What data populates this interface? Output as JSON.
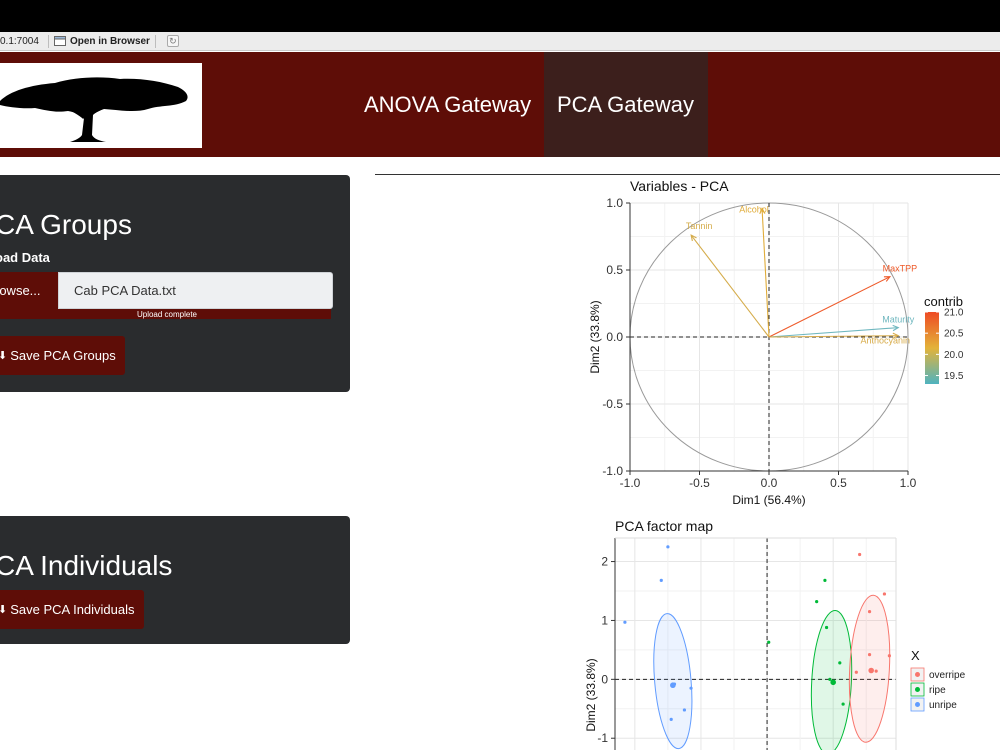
{
  "browser": {
    "url": "0.1:7004",
    "open_label": "Open in Browser"
  },
  "nav": {
    "links": [
      {
        "label": "ANOVA Gateway"
      },
      {
        "label": "PCA Gateway"
      }
    ]
  },
  "groups_panel": {
    "title": "CA Groups",
    "upload_label": "oad Data",
    "browse_label": "rowse...",
    "file_name": "Cab PCA Data.txt",
    "progress_text": "Upload complete",
    "progress": 1.0,
    "save_label": "Save PCA Groups"
  },
  "individuals_panel": {
    "title": "CA Individuals",
    "save_label": "Save PCA Individuals"
  },
  "colors": {
    "nav_bg": "#5e0d07",
    "nav_active": "#3c1f1c",
    "panel_bg": "#2a2c2e",
    "input_bg": "#eef0f2"
  },
  "chart_data": [
    {
      "type": "scatter",
      "title": "Variables - PCA",
      "xlabel": "Dim1 (56.4%)",
      "ylabel": "Dim2 (33.8%)",
      "xlim": [
        -1.0,
        1.0
      ],
      "ylim": [
        -1.0,
        1.0
      ],
      "xticks": [
        "-1.0",
        "-0.5",
        "0.0",
        "0.5",
        "1.0"
      ],
      "yticks": [
        "-1.0",
        "-0.5",
        "0.0",
        "0.5",
        "1.0"
      ],
      "grid": true,
      "circle": true,
      "legend": {
        "title": "contrib",
        "position": "right",
        "ticks": [
          "21.0",
          "20.5",
          "20.0",
          "19.5"
        ],
        "tick_values": [
          21.0,
          20.5,
          20.0,
          19.5
        ],
        "range": [
          19.3,
          21.0
        ],
        "low_color": "#4fb3bf",
        "mid_color": "#e3b33a",
        "high_color": "#ee4b24"
      },
      "arrows": [
        {
          "name": "Tannin",
          "x": -0.56,
          "y": 0.76,
          "color": "#d5ac4b"
        },
        {
          "name": "Alcohol",
          "x": -0.05,
          "y": 0.96,
          "color": "#e0ac3a"
        },
        {
          "name": "MaxTPP",
          "x": 0.87,
          "y": 0.45,
          "color": "#ee5a2a"
        },
        {
          "name": "Maturity",
          "x": 0.93,
          "y": 0.07,
          "color": "#6fb7bf"
        },
        {
          "name": "Anthocyanin",
          "x": 0.93,
          "y": 0.01,
          "color": "#d8ac4a"
        }
      ]
    },
    {
      "type": "scatter",
      "title": "PCA factor map",
      "xlabel": "",
      "ylabel": "Dim2 (33.8%)",
      "ylim": [
        -1.2,
        2.4
      ],
      "yticks": [
        "2",
        "1",
        "0",
        "-1"
      ],
      "grid": true,
      "legend": {
        "title": "X",
        "position": "right",
        "entries": [
          {
            "label": "overripe",
            "color": "#f8766d"
          },
          {
            "label": "ripe",
            "color": "#00ba38"
          },
          {
            "label": "unripe",
            "color": "#619cff"
          }
        ]
      },
      "groups": [
        {
          "name": "unripe",
          "color": "#619cff",
          "points": [
            [
              -3.0,
              2.25
            ],
            [
              -3.2,
              1.68
            ],
            [
              -4.3,
              0.97
            ],
            [
              -2.8,
              -0.08
            ],
            [
              -2.5,
              -0.52
            ],
            [
              -2.3,
              -0.15
            ],
            [
              -2.9,
              -0.68
            ]
          ],
          "centroid": [
            -2.85,
            -0.1
          ],
          "ellipse": {
            "cx": -2.85,
            "cy": -0.03,
            "rx": 0.55,
            "ry": 1.15,
            "rotate": -5
          }
        },
        {
          "name": "ripe",
          "color": "#00ba38",
          "points": [
            [
              1.75,
              1.68
            ],
            [
              1.5,
              1.32
            ],
            [
              1.8,
              0.88
            ],
            [
              2.2,
              0.28
            ],
            [
              1.9,
              0.0
            ],
            [
              2.3,
              -0.42
            ],
            [
              0.05,
              0.63
            ]
          ],
          "centroid": [
            2.0,
            -0.05
          ],
          "ellipse": {
            "cx": 1.95,
            "cy": -0.05,
            "rx": 0.6,
            "ry": 1.22,
            "rotate": 3
          }
        },
        {
          "name": "overripe",
          "color": "#f8766d",
          "points": [
            [
              2.8,
              2.12
            ],
            [
              3.1,
              1.15
            ],
            [
              3.55,
              1.45
            ],
            [
              3.1,
              0.42
            ],
            [
              3.7,
              0.4
            ],
            [
              2.7,
              0.12
            ],
            [
              3.3,
              0.14
            ]
          ],
          "centroid": [
            3.15,
            0.15
          ],
          "ellipse": {
            "cx": 3.1,
            "cy": 0.18,
            "rx": 0.6,
            "ry": 1.25,
            "rotate": 3
          }
        }
      ]
    }
  ]
}
